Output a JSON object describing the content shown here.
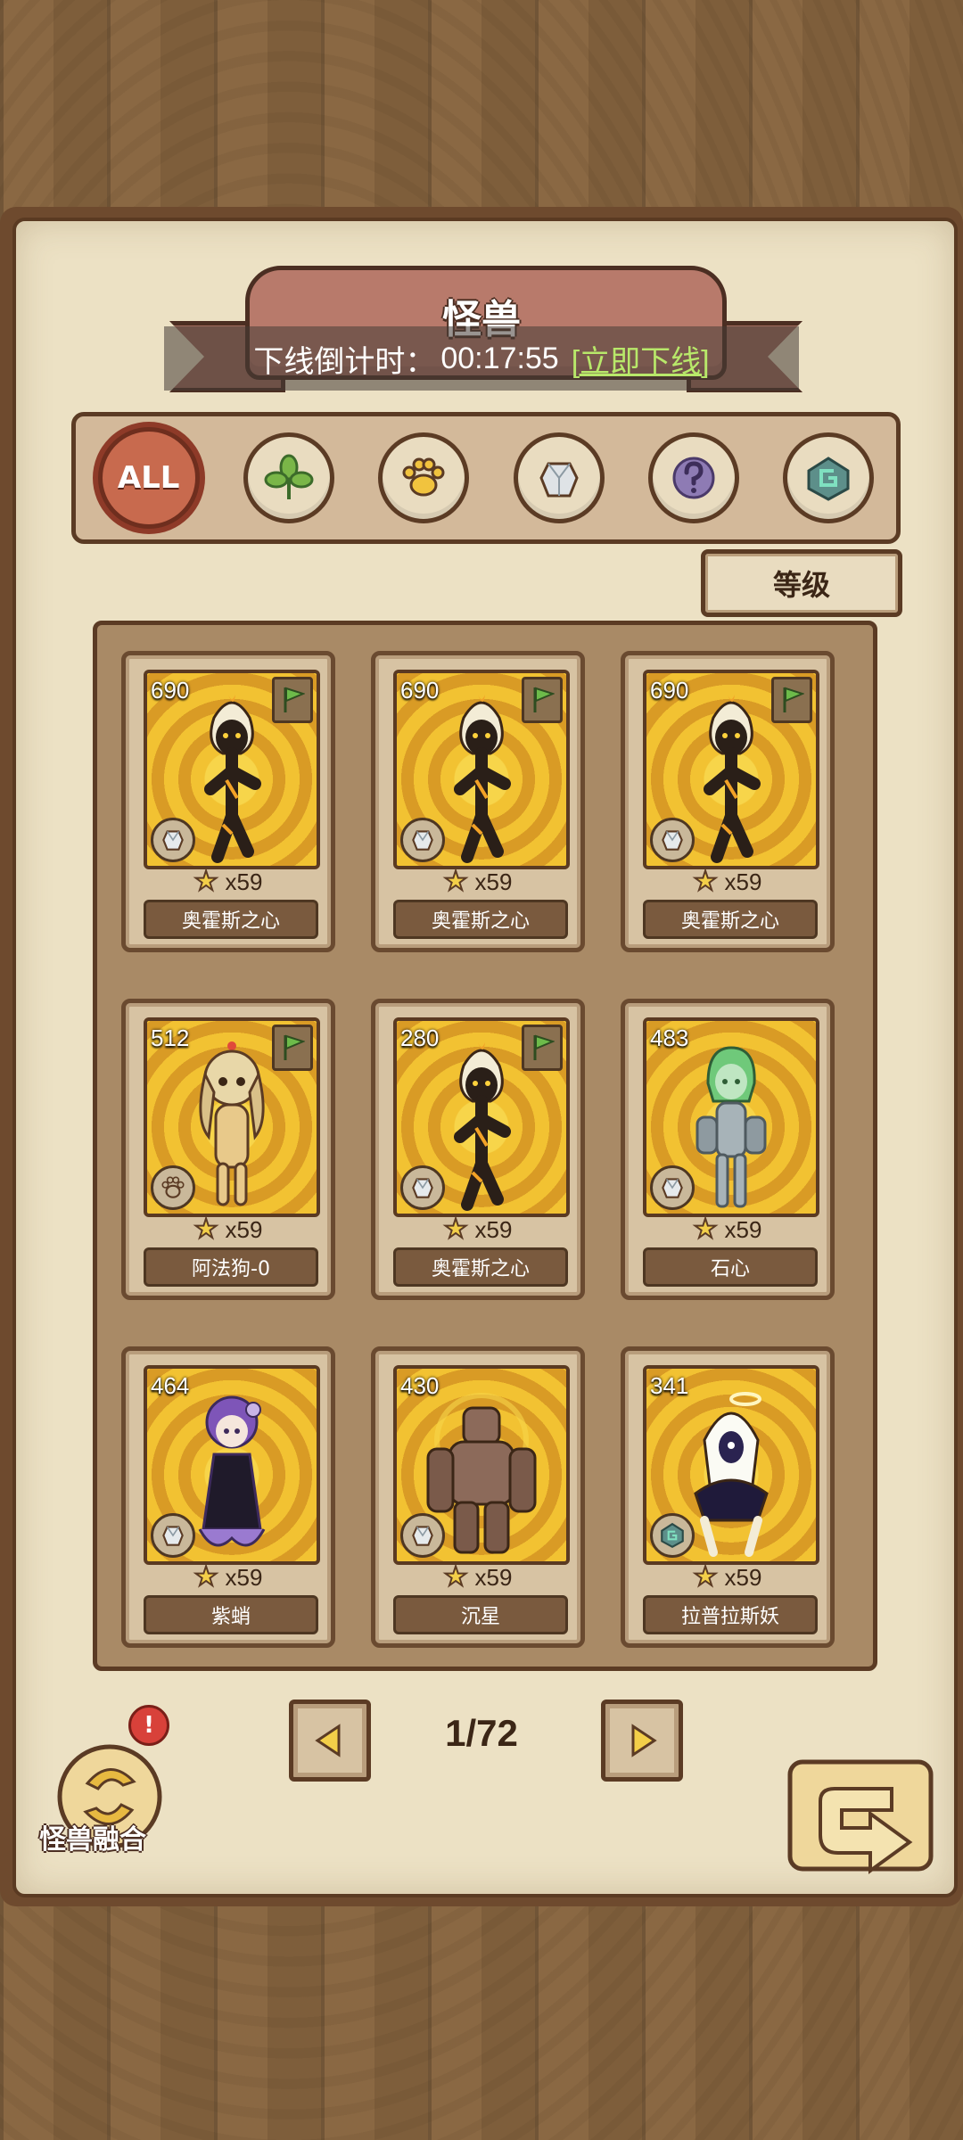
{
  "header": {
    "title": "怪兽",
    "countdown_label": "下线倒计时：",
    "countdown_time": "00:17:55",
    "offline_link": "[立即下线]"
  },
  "filters": [
    {
      "id": "all",
      "label": "ALL",
      "icon": "all-icon",
      "selected": true
    },
    {
      "id": "plant",
      "icon": "leaf-icon"
    },
    {
      "id": "beast",
      "icon": "paw-icon"
    },
    {
      "id": "mineral",
      "icon": "crystal-icon"
    },
    {
      "id": "unknown",
      "icon": "question-icon"
    },
    {
      "id": "arcane",
      "icon": "rune-icon"
    }
  ],
  "sort": {
    "label": "等级"
  },
  "cards": [
    {
      "level": "690",
      "stars": "x59",
      "name": "奥霍斯之心",
      "type": "crystal-icon",
      "flag": true,
      "figure": "flame-girl"
    },
    {
      "level": "690",
      "stars": "x59",
      "name": "奥霍斯之心",
      "type": "crystal-icon",
      "flag": true,
      "figure": "flame-girl"
    },
    {
      "level": "690",
      "stars": "x59",
      "name": "奥霍斯之心",
      "type": "crystal-icon",
      "flag": true,
      "figure": "flame-girl"
    },
    {
      "level": "512",
      "stars": "x59",
      "name": "阿法狗-0",
      "type": "paw-icon",
      "flag": true,
      "figure": "dog-girl"
    },
    {
      "level": "280",
      "stars": "x59",
      "name": "奥霍斯之心",
      "type": "crystal-icon",
      "flag": true,
      "figure": "flame-girl"
    },
    {
      "level": "483",
      "stars": "x59",
      "name": "石心",
      "type": "crystal-icon",
      "flag": false,
      "figure": "stone-girl"
    },
    {
      "level": "464",
      "stars": "x59",
      "name": "紫蛸",
      "type": "crystal-icon",
      "flag": false,
      "figure": "octo-girl"
    },
    {
      "level": "430",
      "stars": "x59",
      "name": "沉星",
      "type": "crystal-icon",
      "flag": false,
      "figure": "golem"
    },
    {
      "level": "341",
      "stars": "x59",
      "name": "拉普拉斯妖",
      "type": "rune-icon",
      "flag": false,
      "figure": "ghost"
    }
  ],
  "pagination": {
    "text": "1/72"
  },
  "fusion": {
    "label": "怪兽融合",
    "alert": "!"
  },
  "colors": {
    "accent": "#c86a4e",
    "link": "#b8e86a",
    "panel": "#ece1c4",
    "frame": "#5b3b24"
  }
}
